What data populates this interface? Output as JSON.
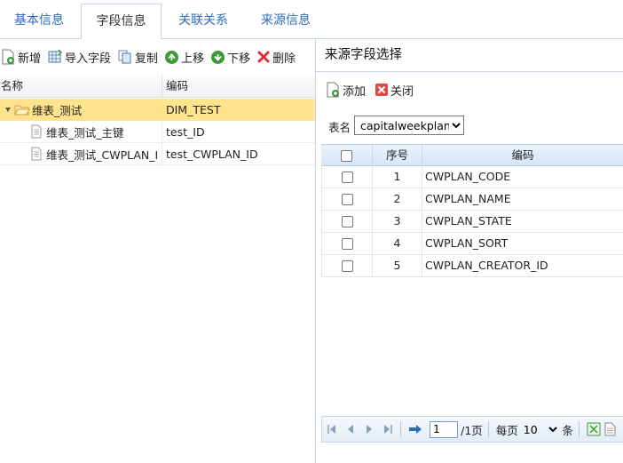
{
  "tabs": [
    {
      "label": "基本信息"
    },
    {
      "label": "字段信息",
      "active": true
    },
    {
      "label": "关联关系"
    },
    {
      "label": "来源信息"
    }
  ],
  "left_toolbar": {
    "add": "新增",
    "import": "导入字段",
    "copy": "复制",
    "move_up": "上移",
    "move_down": "下移",
    "delete": "删除"
  },
  "tree": {
    "headers": {
      "name": "名称",
      "code": "编码"
    },
    "root": {
      "name": "维表_测试",
      "code": "DIM_TEST"
    },
    "children": [
      {
        "name": "维表_测试_主键",
        "code": "test_ID"
      },
      {
        "name": "维表_测试_CWPLAN_I",
        "code": "test_CWPLAN_ID"
      }
    ]
  },
  "right_panel": {
    "title": "来源字段选择",
    "add": "添加",
    "close": "关闭",
    "table_label": "表名",
    "table_value": "capitalweekplan",
    "grid": {
      "headers": {
        "no": "序号",
        "code": "编码"
      },
      "rows": [
        {
          "no": "1",
          "code": "CWPLAN_CODE"
        },
        {
          "no": "2",
          "code": "CWPLAN_NAME"
        },
        {
          "no": "3",
          "code": "CWPLAN_STATE"
        },
        {
          "no": "4",
          "code": "CWPLAN_SORT"
        },
        {
          "no": "5",
          "code": "CWPLAN_CREATOR_ID"
        }
      ]
    },
    "pager": {
      "page_value": "1",
      "total_pages": "/1页",
      "per_page_label": "每页",
      "per_page_value": "10",
      "unit": "条"
    }
  },
  "colors": {
    "accent": "#2d6cb5",
    "selected_row": "#ffe48d",
    "grid_header": "#d6e6f7",
    "delete_red": "#d9322b",
    "up_down_green": "#3a9a3a"
  }
}
